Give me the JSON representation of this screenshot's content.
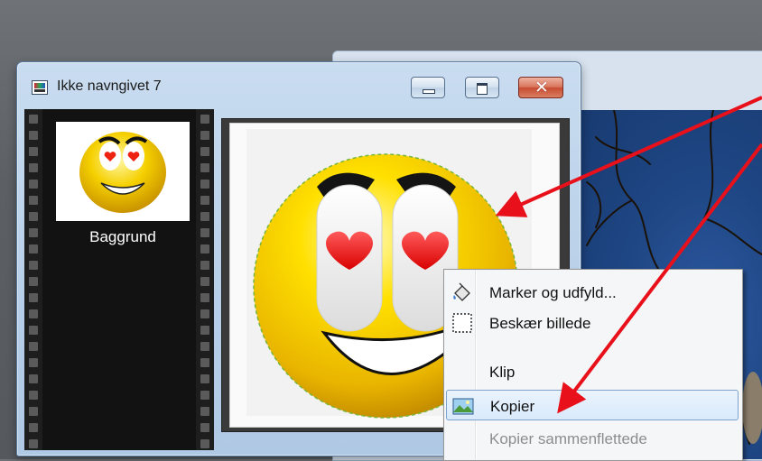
{
  "window": {
    "title": "Ikke navngivet 7",
    "icon": "image-document-icon",
    "controls": {
      "minimize": "minimize-icon",
      "maximize": "maximize-icon",
      "close": "close-icon"
    },
    "close_glyph": "✕"
  },
  "layers": [
    {
      "name": "Baggrund"
    }
  ],
  "context_menu": {
    "items": [
      {
        "label": "Marker og udfyld...",
        "icon": "paint-bucket-icon",
        "state": "normal"
      },
      {
        "label": "Beskær billede",
        "icon": "crop-selection-icon",
        "state": "normal"
      },
      {
        "label": "Klip",
        "icon": "",
        "state": "normal"
      },
      {
        "label": "Kopier",
        "icon": "copy-image-icon",
        "state": "highlighted"
      },
      {
        "label": "Kopier sammenflettede",
        "icon": "",
        "state": "disabled"
      }
    ]
  },
  "colors": {
    "annotation_arrow": "#e8101a",
    "highlight_border": "#7da2ce",
    "titlebar": "#c9dcf0"
  }
}
